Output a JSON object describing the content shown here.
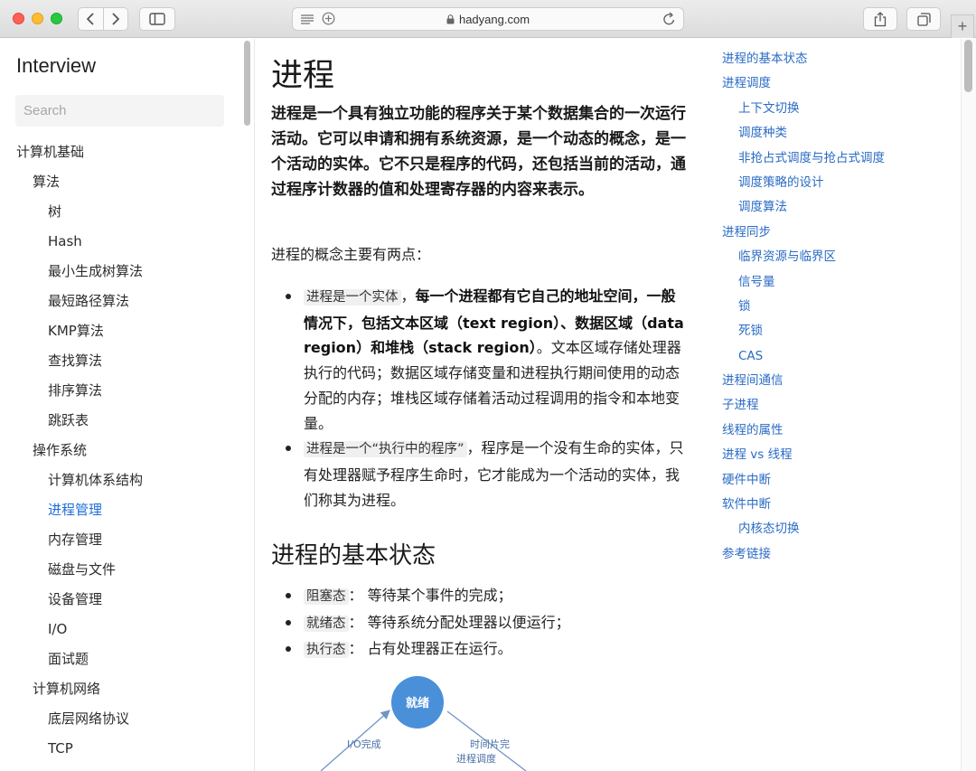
{
  "browser": {
    "url": "hadyang.com"
  },
  "sidebar": {
    "title": "Interview",
    "search_placeholder": "Search",
    "items": [
      {
        "label": "计算机基础",
        "level": 0,
        "active": false
      },
      {
        "label": "算法",
        "level": 1,
        "active": false
      },
      {
        "label": "树",
        "level": 2,
        "active": false
      },
      {
        "label": "Hash",
        "level": 2,
        "active": false
      },
      {
        "label": "最小生成树算法",
        "level": 2,
        "active": false
      },
      {
        "label": "最短路径算法",
        "level": 2,
        "active": false
      },
      {
        "label": "KMP算法",
        "level": 2,
        "active": false
      },
      {
        "label": "查找算法",
        "level": 2,
        "active": false
      },
      {
        "label": "排序算法",
        "level": 2,
        "active": false
      },
      {
        "label": "跳跃表",
        "level": 2,
        "active": false
      },
      {
        "label": "操作系统",
        "level": 1,
        "active": false
      },
      {
        "label": "计算机体系结构",
        "level": 2,
        "active": false
      },
      {
        "label": "进程管理",
        "level": 2,
        "active": true
      },
      {
        "label": "内存管理",
        "level": 2,
        "active": false
      },
      {
        "label": "磁盘与文件",
        "level": 2,
        "active": false
      },
      {
        "label": "设备管理",
        "level": 2,
        "active": false
      },
      {
        "label": "I/O",
        "level": 2,
        "active": false
      },
      {
        "label": "面试题",
        "level": 2,
        "active": false
      },
      {
        "label": "计算机网络",
        "level": 1,
        "active": false
      },
      {
        "label": "底层网络协议",
        "level": 2,
        "active": false
      },
      {
        "label": "TCP",
        "level": 2,
        "active": false
      }
    ]
  },
  "article": {
    "title": "进程",
    "lead": "进程是一个具有独立功能的程序关于某个数据集合的一次运行活动。它可以申请和拥有系统资源，是一个动态的概念，是一个活动的实体。它不只是程序的代码，还包括当前的活动，通过程序计数器的值和处理寄存器的内容来表示。",
    "intro": "进程的概念主要有两点：",
    "points": [
      {
        "code": "进程是一个实体",
        "sep": "，",
        "bold": "每一个进程都有它自己的地址空间，一般情况下，包括文本区域（text region）、数据区域（data region）和堆栈（stack region）",
        "text": "。文本区域存储处理器执行的代码；数据区域存储变量和进程执行期间使用的动态分配的内存；堆栈区域存储着活动过程调用的指令和本地变量。"
      },
      {
        "code": "进程是一个“执行中的程序”",
        "sep": "，",
        "bold": "",
        "text": "程序是一个没有生命的实体，只有处理器赋予程序生命时，它才能成为一个活动的实体，我们称其为进程。"
      }
    ],
    "section_title": "进程的基本状态",
    "states": [
      {
        "code": "阻塞态",
        "text": "： 等待某个事件的完成；"
      },
      {
        "code": "就绪态",
        "text": "： 等待系统分配处理器以便运行；"
      },
      {
        "code": "执行态",
        "text": "： 占有处理器正在运行。"
      }
    ],
    "diagram": {
      "node_label": "就绪",
      "left_edge_label": "I/O完成",
      "right_edge_label_1": "时间片完",
      "right_edge_label_2": "进程调度",
      "node_color": "#4a90d9"
    }
  },
  "toc": {
    "items": [
      {
        "label": "进程的基本状态",
        "sub": false
      },
      {
        "label": "进程调度",
        "sub": false
      },
      {
        "label": "上下文切换",
        "sub": true
      },
      {
        "label": "调度种类",
        "sub": true
      },
      {
        "label": "非抢占式调度与抢占式调度",
        "sub": true
      },
      {
        "label": "调度策略的设计",
        "sub": true
      },
      {
        "label": "调度算法",
        "sub": true
      },
      {
        "label": "进程同步",
        "sub": false
      },
      {
        "label": "临界资源与临界区",
        "sub": true
      },
      {
        "label": "信号量",
        "sub": true
      },
      {
        "label": "锁",
        "sub": true
      },
      {
        "label": "死锁",
        "sub": true
      },
      {
        "label": "CAS",
        "sub": true
      },
      {
        "label": "进程间通信",
        "sub": false
      },
      {
        "label": "子进程",
        "sub": false
      },
      {
        "label": "线程的属性",
        "sub": false
      },
      {
        "label": "进程 vs 线程",
        "sub": false
      },
      {
        "label": "硬件中断",
        "sub": false
      },
      {
        "label": "软件中断",
        "sub": false
      },
      {
        "label": "内核态切换",
        "sub": true
      },
      {
        "label": "参考链接",
        "sub": false
      }
    ],
    "link_color": "#2a6bc5"
  }
}
